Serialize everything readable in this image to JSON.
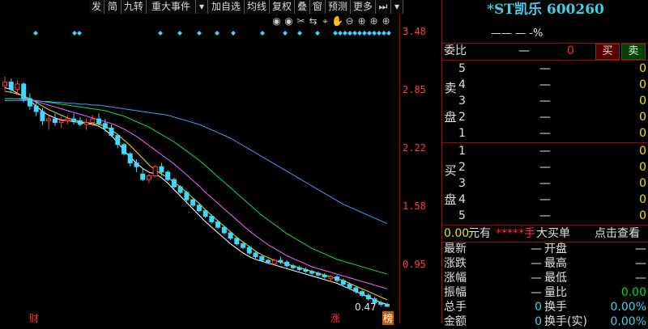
{
  "toolbar": {
    "items": [
      "发",
      "简",
      "九转",
      "重大事件",
      "▾",
      "加自选",
      "均线",
      "复权",
      "叠",
      "窗",
      "预测",
      "更多",
      "⏭",
      "▾"
    ],
    "icons": [
      "eye-icon",
      "eye-icon",
      "scissors-icon",
      "swap-icon",
      "cursor-icon",
      "hand-icon",
      "zoom-out-icon",
      "zoom-in-icon",
      "zoom-in-icon",
      "zoom-in-icon"
    ]
  },
  "chart": {
    "y_labels": [
      "3.48",
      "2.85",
      "2.22",
      "1.58",
      "0.95"
    ],
    "low_label": "0.47",
    "bottom_tags": [
      "财",
      "涨",
      "榜"
    ],
    "colors": {
      "up": "#ff4040",
      "down": "#3fd8ff",
      "ma5": "#ffffff",
      "ma10": "#f0e000",
      "ma20": "#ff60ff",
      "ma30": "#00e060",
      "ma60": "#3aa0ff",
      "diamond": "#3fd0ff"
    }
  },
  "chart_data": {
    "type": "candlestick",
    "ylim": [
      0.47,
      3.48
    ],
    "y_ticks": [
      3.48,
      2.85,
      2.22,
      1.58,
      0.95
    ],
    "ohlc": [
      [
        2.88,
        2.98,
        2.83,
        2.92
      ],
      [
        2.92,
        2.96,
        2.8,
        2.84
      ],
      [
        2.84,
        2.94,
        2.78,
        2.9
      ],
      [
        2.9,
        2.92,
        2.7,
        2.74
      ],
      [
        2.74,
        2.8,
        2.62,
        2.66
      ],
      [
        2.66,
        2.72,
        2.55,
        2.6
      ],
      [
        2.6,
        2.64,
        2.45,
        2.5
      ],
      [
        2.5,
        2.56,
        2.4,
        2.52
      ],
      [
        2.52,
        2.58,
        2.44,
        2.48
      ],
      [
        2.48,
        2.54,
        2.42,
        2.5
      ],
      [
        2.5,
        2.56,
        2.46,
        2.52
      ],
      [
        2.52,
        2.58,
        2.46,
        2.5
      ],
      [
        2.5,
        2.54,
        2.44,
        2.46
      ],
      [
        2.46,
        2.52,
        2.4,
        2.48
      ],
      [
        2.48,
        2.56,
        2.44,
        2.52
      ],
      [
        2.52,
        2.58,
        2.45,
        2.47
      ],
      [
        2.47,
        2.52,
        2.38,
        2.42
      ],
      [
        2.42,
        2.46,
        2.32,
        2.34
      ],
      [
        2.34,
        2.36,
        2.2,
        2.24
      ],
      [
        2.24,
        2.26,
        2.12,
        2.14
      ],
      [
        2.14,
        2.16,
        2.0,
        2.04
      ],
      [
        2.04,
        2.08,
        1.94,
        2.0
      ],
      [
        1.92,
        1.98,
        1.84,
        1.86
      ],
      [
        1.86,
        1.92,
        1.82,
        1.9
      ],
      [
        1.9,
        2.02,
        1.88,
        2.0
      ],
      [
        2.0,
        2.04,
        1.9,
        1.94
      ],
      [
        1.94,
        1.96,
        1.84,
        1.86
      ],
      [
        1.86,
        1.88,
        1.76,
        1.78
      ],
      [
        1.78,
        1.8,
        1.7,
        1.72
      ],
      [
        1.72,
        1.74,
        1.62,
        1.64
      ],
      [
        1.64,
        1.66,
        1.56,
        1.58
      ],
      [
        1.58,
        1.6,
        1.5,
        1.52
      ],
      [
        1.52,
        1.54,
        1.44,
        1.46
      ],
      [
        1.46,
        1.48,
        1.38,
        1.4
      ],
      [
        1.4,
        1.42,
        1.32,
        1.34
      ],
      [
        1.34,
        1.36,
        1.26,
        1.28
      ],
      [
        1.28,
        1.3,
        1.2,
        1.22
      ],
      [
        1.22,
        1.24,
        1.14,
        1.16
      ],
      [
        1.16,
        1.18,
        1.1,
        1.12
      ],
      [
        1.12,
        1.14,
        1.04,
        1.06
      ],
      [
        1.06,
        1.08,
        1.0,
        1.02
      ],
      [
        1.02,
        1.04,
        0.96,
        0.98
      ],
      [
        0.98,
        1.0,
        0.94,
        0.96
      ],
      [
        0.94,
        1.0,
        0.92,
        0.98
      ],
      [
        0.98,
        1.02,
        0.94,
        0.96
      ],
      [
        0.96,
        0.98,
        0.9,
        0.92
      ],
      [
        0.92,
        0.94,
        0.88,
        0.9
      ],
      [
        0.9,
        0.92,
        0.86,
        0.88
      ],
      [
        0.88,
        0.9,
        0.84,
        0.86
      ],
      [
        0.86,
        0.88,
        0.82,
        0.84
      ],
      [
        0.84,
        0.86,
        0.8,
        0.82
      ],
      [
        0.82,
        0.84,
        0.78,
        0.8
      ],
      [
        0.78,
        0.82,
        0.74,
        0.8
      ],
      [
        0.8,
        0.82,
        0.74,
        0.76
      ],
      [
        0.76,
        0.78,
        0.7,
        0.72
      ],
      [
        0.72,
        0.74,
        0.66,
        0.68
      ],
      [
        0.68,
        0.7,
        0.62,
        0.64
      ],
      [
        0.64,
        0.66,
        0.58,
        0.6
      ],
      [
        0.6,
        0.62,
        0.54,
        0.56
      ],
      [
        0.56,
        0.58,
        0.5,
        0.52
      ],
      [
        0.52,
        0.54,
        0.48,
        0.5
      ],
      [
        0.5,
        0.52,
        0.47,
        0.48
      ]
    ],
    "ma_series": [
      {
        "name": "",
        "color": "#ffffff",
        "values": [
          2.86,
          2.84,
          2.8,
          2.76,
          2.72,
          2.66,
          2.6,
          2.56,
          2.53,
          2.51,
          2.5,
          2.49,
          2.48,
          2.47,
          2.46,
          2.44,
          2.4,
          2.34,
          2.26,
          2.18,
          2.1,
          2.04,
          1.98,
          1.94,
          1.92,
          1.88,
          1.82,
          1.75,
          1.68,
          1.61,
          1.54,
          1.47,
          1.4,
          1.34,
          1.28,
          1.22,
          1.16,
          1.11,
          1.06,
          1.02,
          0.99,
          0.97,
          0.95,
          0.93,
          0.91,
          0.89,
          0.87,
          0.85,
          0.83,
          0.81,
          0.79,
          0.77,
          0.75,
          0.73,
          0.7,
          0.67,
          0.64,
          0.61,
          0.58,
          0.55,
          0.52,
          0.5
        ]
      },
      {
        "name": "",
        "color": "#f0e000",
        "values": [
          2.82,
          2.81,
          2.79,
          2.77,
          2.74,
          2.7,
          2.66,
          2.62,
          2.59,
          2.56,
          2.53,
          2.51,
          2.49,
          2.48,
          2.47,
          2.46,
          2.44,
          2.4,
          2.35,
          2.29,
          2.23,
          2.16,
          2.09,
          2.02,
          1.96,
          1.92,
          1.88,
          1.83,
          1.78,
          1.72,
          1.66,
          1.6,
          1.53,
          1.47,
          1.41,
          1.35,
          1.29,
          1.23,
          1.18,
          1.13,
          1.08,
          1.04,
          1.01,
          0.98,
          0.96,
          0.94,
          0.92,
          0.9,
          0.88,
          0.86,
          0.84,
          0.82,
          0.8,
          0.78,
          0.76,
          0.73,
          0.7,
          0.67,
          0.64,
          0.61,
          0.58,
          0.55
        ]
      },
      {
        "name": "",
        "color": "#ff60ff",
        "values": [
          2.74,
          2.74,
          2.74,
          2.73,
          2.72,
          2.71,
          2.69,
          2.67,
          2.65,
          2.63,
          2.61,
          2.59,
          2.57,
          2.55,
          2.53,
          2.51,
          2.49,
          2.47,
          2.44,
          2.41,
          2.37,
          2.33,
          2.28,
          2.23,
          2.18,
          2.13,
          2.08,
          2.03,
          1.97,
          1.91,
          1.85,
          1.79,
          1.72,
          1.66,
          1.6,
          1.54,
          1.48,
          1.42,
          1.36,
          1.3,
          1.25,
          1.2,
          1.15,
          1.11,
          1.07,
          1.03,
          1.0,
          0.97,
          0.94,
          0.91,
          0.89,
          0.87,
          0.85,
          0.83,
          0.81,
          0.79,
          0.77,
          0.75,
          0.73,
          0.71,
          0.69,
          0.67
        ]
      },
      {
        "name": "",
        "color": "#00e060",
        "values": [
          2.74,
          2.74,
          2.74,
          2.74,
          2.73,
          2.72,
          2.71,
          2.7,
          2.69,
          2.68,
          2.67,
          2.66,
          2.65,
          2.64,
          2.63,
          2.62,
          2.61,
          2.59,
          2.57,
          2.55,
          2.52,
          2.49,
          2.46,
          2.43,
          2.39,
          2.35,
          2.31,
          2.27,
          2.22,
          2.17,
          2.12,
          2.07,
          2.01,
          1.95,
          1.89,
          1.83,
          1.77,
          1.71,
          1.65,
          1.59,
          1.53,
          1.47,
          1.42,
          1.37,
          1.32,
          1.27,
          1.23,
          1.19,
          1.15,
          1.11,
          1.08,
          1.05,
          1.02,
          0.99,
          0.97,
          0.95,
          0.93,
          0.91,
          0.89,
          0.87,
          0.85,
          0.83
        ]
      },
      {
        "name": "",
        "color": "#3aa0ff",
        "values": [
          2.72,
          2.72,
          2.72,
          2.72,
          2.72,
          2.72,
          2.71,
          2.71,
          2.7,
          2.7,
          2.69,
          2.69,
          2.68,
          2.68,
          2.67,
          2.67,
          2.66,
          2.65,
          2.64,
          2.63,
          2.62,
          2.61,
          2.6,
          2.59,
          2.58,
          2.57,
          2.56,
          2.54,
          2.52,
          2.5,
          2.48,
          2.46,
          2.43,
          2.4,
          2.37,
          2.34,
          2.31,
          2.27,
          2.23,
          2.19,
          2.15,
          2.11,
          2.07,
          2.03,
          1.99,
          1.95,
          1.91,
          1.87,
          1.83,
          1.79,
          1.75,
          1.71,
          1.67,
          1.63,
          1.59,
          1.56,
          1.53,
          1.5,
          1.47,
          1.44,
          1.41,
          1.38
        ]
      }
    ]
  },
  "panel": {
    "title": "*ST凯乐 600260",
    "change": "—— — -%",
    "weibi_label": "委比",
    "weibi_value": "—",
    "weibi_diff": "0",
    "buy_btn": "买",
    "sell_btn": "卖",
    "sell_label_1": "卖",
    "sell_label_2": "盘",
    "buy_label_1": "买",
    "buy_label_2": "盘",
    "sell_levels": [
      {
        "lvl": "5",
        "price": "—",
        "vol": "0"
      },
      {
        "lvl": "4",
        "price": "—",
        "vol": "0"
      },
      {
        "lvl": "3",
        "price": "—",
        "vol": "0"
      },
      {
        "lvl": "2",
        "price": "—",
        "vol": "0"
      },
      {
        "lvl": "1",
        "price": "—",
        "vol": "0"
      }
    ],
    "buy_levels": [
      {
        "lvl": "1",
        "price": "—",
        "vol": "0"
      },
      {
        "lvl": "2",
        "price": "—",
        "vol": "0"
      },
      {
        "lvl": "3",
        "price": "—",
        "vol": "0"
      },
      {
        "lvl": "4",
        "price": "—",
        "vol": "0"
      },
      {
        "lvl": "5",
        "price": "—",
        "vol": "0"
      }
    ],
    "big_order": {
      "amount": "0.00",
      "unit": "元有",
      "stars": "*****手",
      "label": "大买单",
      "link": "点击查看"
    },
    "stats": [
      {
        "l1": "最新",
        "v1": "—",
        "l2": "开盘",
        "v2": "—"
      },
      {
        "l1": "涨跌",
        "v1": "—",
        "l2": "最高",
        "v2": "—"
      },
      {
        "l1": "涨幅",
        "v1": "—",
        "l2": "最低",
        "v2": "—"
      },
      {
        "l1": "振幅",
        "v1": "—",
        "l2": "量比",
        "v2": "0.00"
      },
      {
        "l1": "总手",
        "v1": "0",
        "l2": "换手",
        "v2": "0.00%"
      },
      {
        "l1": "金额",
        "v1": "0",
        "l2": "换手(实)",
        "v2": "0.00%"
      }
    ]
  }
}
